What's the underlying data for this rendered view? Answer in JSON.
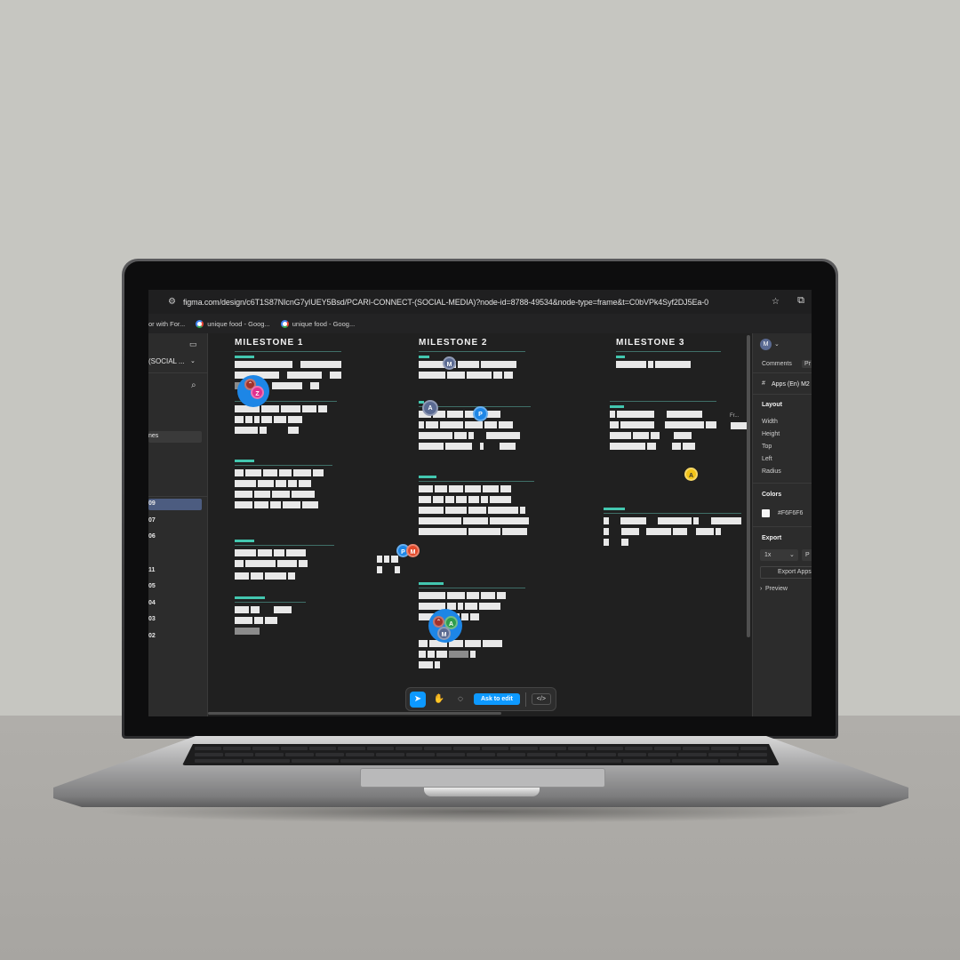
{
  "browser": {
    "url": "figma.com/design/c6T1S87NIcnG7yIUEY5Bsd/PCARI-CONNECT-(SOCIAL-MEDIA)?node-id=8788-49534&node-type=frame&t=C0bVPk4Syf2DJ5Ea-0",
    "bookmarks": [
      {
        "label": "or with For..."
      },
      {
        "label": "unique food - Goog..."
      },
      {
        "label": "unique food - Goog..."
      }
    ],
    "icons": {
      "site_info": "tune-icon",
      "bookmark": "star-icon",
      "extensions": "extension-icon"
    }
  },
  "left_panel": {
    "file_name": "(SOCIAL ...",
    "pages_label": "nes",
    "layers": [
      "09",
      "07",
      "06",
      "11",
      "05",
      "04",
      "03",
      "02"
    ]
  },
  "canvas": {
    "milestones": [
      {
        "title": "MILESTONE 1"
      },
      {
        "title": "MILESTONE 2"
      },
      {
        "title": "MILESTONE 3"
      }
    ],
    "cursors": [
      {
        "initial": "Z",
        "color": "#e0308f"
      },
      {
        "initial": "M",
        "color": "#5a6a92"
      },
      {
        "initial": "A",
        "color": "#5a6a92"
      },
      {
        "initial": "P",
        "color": "#1d86e6"
      },
      {
        "initial": "P",
        "color": "#1d86e6"
      },
      {
        "initial": "M",
        "color": "#e24a2b"
      },
      {
        "initial": "A",
        "color": "#2e9e4d"
      },
      {
        "initial": "M",
        "color": "#5a6a92"
      },
      {
        "initial": "A",
        "color": "#f2c318"
      }
    ],
    "frame_label": "Fr..."
  },
  "toolbar": {
    "ask_to_edit": "Ask to edit",
    "code_label": "</>"
  },
  "right_panel": {
    "user_initial": "M",
    "tabs": [
      "Comments",
      "Pr"
    ],
    "frame_name": "Apps (En) M2",
    "layout_heading": "Layout",
    "layout_fields": [
      "Width",
      "Height",
      "Top",
      "Left",
      "Radius"
    ],
    "colors_heading": "Colors",
    "color_value": "#F6F6F6",
    "export_heading": "Export",
    "export_scale": "1x",
    "export_format": "P",
    "export_button": "Export Apps",
    "preview_label": "Preview"
  }
}
